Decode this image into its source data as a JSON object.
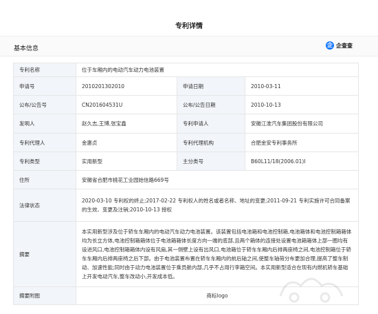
{
  "page_title": "专利详情",
  "section_title": "基本信息",
  "brand": {
    "icon_text": "企",
    "label": "企查查",
    "color": "#1677ff"
  },
  "rows": {
    "name": {
      "label": "专利名称",
      "value": "位于车厢内的电动汽车动力电池装置"
    },
    "app_no": {
      "label": "申请号",
      "value": "2010201302010"
    },
    "app_date": {
      "label": "申请日期",
      "value": "2010-03-11"
    },
    "pub_no": {
      "label": "公布/公告号",
      "value": "CN201604531U"
    },
    "pub_date": {
      "label": "公布/公告日期",
      "value": "2010-10-13"
    },
    "inventor": {
      "label": "发明人",
      "value": "赵久志,王博,张宝鑫"
    },
    "applicant": {
      "label": "专利申请人",
      "value": "安徽江淮汽车集团股份有限公司"
    },
    "agent": {
      "label": "专利代理人",
      "value": "金惠贞"
    },
    "agency": {
      "label": "专利代理机构",
      "value": "合肥金安专利事务所"
    },
    "type": {
      "label": "专利类型",
      "value": "实用新型"
    },
    "main_class": {
      "label": "主分类号",
      "value": "B60L11/18(2006.01)I"
    },
    "address": {
      "label": "住所",
      "value": "安徽省合肥市桃花工业园始信路669号"
    },
    "legal": {
      "label": "法律状态",
      "value": "2020-03-10 专利权的终止;2017-02-22 专利权人的姓名或者名称、地址的变更;2011-09-21 专利实施许可合同备案的生效、变更及注销;2010-10-13 授权"
    },
    "abstract": {
      "label": "摘要",
      "value": "本实用新型涉及位于轿车车厢内的电动汽车动力电池装置。该装置包括电池箱和电池控制箱,电池箱体和电池控制箱箱体均为长立方体,电池控制箱箱体位于电池箱箱体长度方向一端的底部,且两个箱体的连接处设置电池箱箱体上部一圈均有设进风口,电池控制箱箱体内设有风扇,其一侧壁上设有出风口,电池箱位于轿车车厢内后排两座椅之间,电池控制箱位于轿车车厢内后排两座椅之后下部。由于电池装置布置在轿车车厢内的前后轴之间,使整车轴荷分布更加合理,提高了整车制动、加速性能;同时由于动力电池装置位于乘员舱内部,几乎不占用行李箱空间。本实用新型适合在现有内燃机轿车基础上开发电动汽车,整车改动小,开发成本低。"
    },
    "abstract_fig": {
      "label": "摘要附图",
      "value": "商标logo"
    }
  }
}
